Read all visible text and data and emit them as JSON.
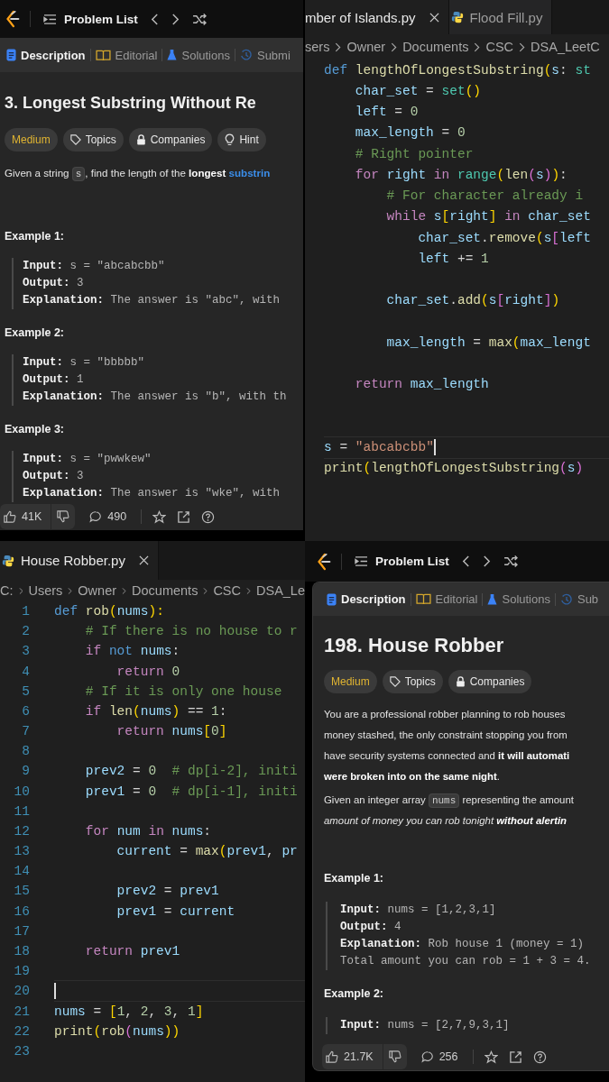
{
  "panels": [
    {
      "kind": "problem",
      "header": {
        "label": "Problem List"
      },
      "tabs": [
        {
          "kind": "description",
          "label": "Description",
          "selected": true
        },
        {
          "kind": "editorial",
          "label": "Editorial",
          "selected": false
        },
        {
          "kind": "solutions",
          "label": "Solutions",
          "selected": false
        },
        {
          "kind": "submissions",
          "label": "Submi",
          "selected": false
        }
      ],
      "title": "3. Longest Substring Without Re",
      "tags": [
        {
          "kind": "difficulty",
          "label": "Medium"
        },
        {
          "kind": "topics",
          "label": "Topics"
        },
        {
          "kind": "companies",
          "label": "Companies"
        },
        {
          "kind": "hint",
          "label": "Hint"
        }
      ],
      "paragraphs": [
        {
          "parts": [
            {
              "kind": "text",
              "text": "Given a string "
            },
            {
              "kind": "code",
              "text": "s"
            },
            {
              "kind": "text",
              "text": ", find the length of the **longest** "
            },
            {
              "kind": "link",
              "text": "substrin"
            }
          ]
        }
      ],
      "examples": [
        {
          "heading": "Example 1:",
          "lines": [
            {
              "label": "Input:",
              "value": "s = \"abcabcbb\""
            },
            {
              "label": "Output:",
              "value": "3"
            },
            {
              "label": "Explanation:",
              "value": "The answer is \"abc\", with"
            }
          ]
        },
        {
          "heading": "Example 2:",
          "lines": [
            {
              "label": "Input:",
              "value": "s = \"bbbbb\""
            },
            {
              "label": "Output:",
              "value": "1"
            },
            {
              "label": "Explanation:",
              "value": "The answer is \"b\", with th"
            }
          ]
        },
        {
          "heading": "Example 3:",
          "lines": [
            {
              "label": "Input:",
              "value": "s = \"pwwkew\""
            },
            {
              "label": "Output:",
              "value": "3"
            },
            {
              "label": "Explanation:",
              "value": "The answer is \"wke\", with"
            }
          ]
        }
      ],
      "footer": {
        "likes": "41K",
        "comments": "490"
      }
    },
    {
      "kind": "editor",
      "tabs": [
        {
          "label": "mber of Islands.py",
          "selected": true,
          "has_icon": false,
          "closable": true
        },
        {
          "label": "Flood Fill.py",
          "selected": false,
          "has_icon": true,
          "closable": false
        }
      ],
      "breadcrumb": [
        "sers",
        "Owner",
        "Documents",
        "CSC",
        "DSA_LeetC"
      ],
      "lines": [
        {
          "current": false,
          "tokens": [
            {
              "text": "def ",
              "kind": "st"
            },
            {
              "text": "lengthOfLongestSubstring",
              "kind": "fn"
            },
            {
              "text": "(",
              "kind": "b1"
            },
            {
              "text": "s",
              "kind": "var"
            },
            {
              "text": ": ",
              "kind": "op"
            },
            {
              "text": "st",
              "kind": "ty"
            }
          ]
        },
        {
          "current": false,
          "tokens": [
            {
              "text": "    char_set",
              "kind": "var"
            },
            {
              "text": " = ",
              "kind": "op"
            },
            {
              "text": "set",
              "kind": "ty"
            },
            {
              "text": "()",
              "kind": "b1"
            }
          ]
        },
        {
          "current": false,
          "tokens": [
            {
              "text": "    left",
              "kind": "var"
            },
            {
              "text": " = ",
              "kind": "op"
            },
            {
              "text": "0",
              "kind": "num"
            }
          ]
        },
        {
          "current": false,
          "tokens": [
            {
              "text": "    max_length",
              "kind": "var"
            },
            {
              "text": " = ",
              "kind": "op"
            },
            {
              "text": "0",
              "kind": "num"
            }
          ]
        },
        {
          "current": false,
          "tokens": [
            {
              "text": "    # Right pointer",
              "kind": "cm"
            }
          ]
        },
        {
          "current": false,
          "tokens": [
            {
              "text": "    for ",
              "kind": "kw"
            },
            {
              "text": "right ",
              "kind": "var"
            },
            {
              "text": "in ",
              "kind": "kw"
            },
            {
              "text": "range",
              "kind": "ty"
            },
            {
              "text": "(",
              "kind": "b1"
            },
            {
              "text": "len",
              "kind": "fn"
            },
            {
              "text": "(",
              "kind": "b2"
            },
            {
              "text": "s",
              "kind": "var"
            },
            {
              "text": ")",
              "kind": "b2"
            },
            {
              "text": ")",
              "kind": "b1"
            },
            {
              "text": ":",
              "kind": "op"
            }
          ]
        },
        {
          "current": false,
          "tokens": [
            {
              "text": "        # For character already i",
              "kind": "cm"
            }
          ]
        },
        {
          "current": false,
          "tokens": [
            {
              "text": "        while ",
              "kind": "kw"
            },
            {
              "text": "s",
              "kind": "var"
            },
            {
              "text": "[",
              "kind": "b1"
            },
            {
              "text": "right",
              "kind": "var"
            },
            {
              "text": "]",
              "kind": "b1"
            },
            {
              "text": " in ",
              "kind": "kw"
            },
            {
              "text": "char_set",
              "kind": "var"
            }
          ]
        },
        {
          "current": false,
          "tokens": [
            {
              "text": "            char_set",
              "kind": "var"
            },
            {
              "text": ".",
              "kind": "op"
            },
            {
              "text": "remove",
              "kind": "fn"
            },
            {
              "text": "(",
              "kind": "b1"
            },
            {
              "text": "s",
              "kind": "var"
            },
            {
              "text": "[",
              "kind": "b2"
            },
            {
              "text": "left",
              "kind": "var"
            }
          ]
        },
        {
          "current": false,
          "tokens": [
            {
              "text": "            left",
              "kind": "var"
            },
            {
              "text": " += ",
              "kind": "op"
            },
            {
              "text": "1",
              "kind": "num"
            }
          ]
        },
        {
          "current": false
        },
        {
          "current": false,
          "tokens": [
            {
              "text": "        char_set",
              "kind": "var"
            },
            {
              "text": ".",
              "kind": "op"
            },
            {
              "text": "add",
              "kind": "fn"
            },
            {
              "text": "(",
              "kind": "b1"
            },
            {
              "text": "s",
              "kind": "var"
            },
            {
              "text": "[",
              "kind": "b2"
            },
            {
              "text": "right",
              "kind": "var"
            },
            {
              "text": "]",
              "kind": "b2"
            },
            {
              "text": ")",
              "kind": "b1"
            }
          ]
        },
        {
          "current": false
        },
        {
          "current": false,
          "tokens": [
            {
              "text": "        max_length",
              "kind": "var"
            },
            {
              "text": " = ",
              "kind": "op"
            },
            {
              "text": "max",
              "kind": "fn"
            },
            {
              "text": "(",
              "kind": "b1"
            },
            {
              "text": "max_lengt",
              "kind": "var"
            }
          ]
        },
        {
          "current": false
        },
        {
          "current": false,
          "tokens": [
            {
              "text": "    return ",
              "kind": "kw"
            },
            {
              "text": "max_length",
              "kind": "var"
            }
          ]
        },
        {
          "current": false
        },
        {
          "current": false
        },
        {
          "current": true,
          "tokens": [
            {
              "text": "s",
              "kind": "var"
            },
            {
              "text": " = ",
              "kind": "op"
            },
            {
              "text": "\"abcabcbb\"",
              "kind": "str"
            }
          ]
        },
        {
          "current": false,
          "tokens": [
            {
              "text": "print",
              "kind": "fn"
            },
            {
              "text": "(",
              "kind": "b1"
            },
            {
              "text": "lengthOfLongestSubstring",
              "kind": "fn"
            },
            {
              "text": "(",
              "kind": "b2"
            },
            {
              "text": "s",
              "kind": "var"
            },
            {
              "text": ")",
              "kind": "b2"
            }
          ]
        }
      ]
    },
    {
      "kind": "editor",
      "tabs": [
        {
          "label": "House Robber.py",
          "selected": true,
          "has_icon": true,
          "closable": true
        }
      ],
      "breadcrumb": [
        "C:",
        "Users",
        "Owner",
        "Documents",
        "CSC",
        "DSA_Le"
      ],
      "lines": [
        {
          "number": "1",
          "current": false,
          "tokens": [
            {
              "text": "def ",
              "kind": "st"
            },
            {
              "text": "rob",
              "kind": "fn"
            },
            {
              "text": "(",
              "kind": "b1"
            },
            {
              "text": "nums",
              "kind": "var"
            },
            {
              "text": "):",
              "kind": "b1"
            }
          ]
        },
        {
          "number": "2",
          "current": false,
          "tokens": [
            {
              "text": "    # If there is no house to r",
              "kind": "cm"
            }
          ]
        },
        {
          "number": "3",
          "current": false,
          "tokens": [
            {
              "text": "    if ",
              "kind": "kw"
            },
            {
              "text": "not ",
              "kind": "st"
            },
            {
              "text": "nums",
              "kind": "var"
            },
            {
              "text": ":",
              "kind": "op"
            }
          ]
        },
        {
          "number": "4",
          "current": false,
          "tokens": [
            {
              "text": "        return ",
              "kind": "kw"
            },
            {
              "text": "0",
              "kind": "num"
            }
          ]
        },
        {
          "number": "5",
          "current": false,
          "tokens": [
            {
              "text": "    # If it is only one house",
              "kind": "cm"
            }
          ]
        },
        {
          "number": "6",
          "current": false,
          "tokens": [
            {
              "text": "    if ",
              "kind": "kw"
            },
            {
              "text": "len",
              "kind": "fn"
            },
            {
              "text": "(",
              "kind": "b1"
            },
            {
              "text": "nums",
              "kind": "var"
            },
            {
              "text": ")",
              "kind": "b1"
            },
            {
              "text": " == ",
              "kind": "op"
            },
            {
              "text": "1",
              "kind": "num"
            },
            {
              "text": ":",
              "kind": "op"
            }
          ]
        },
        {
          "number": "7",
          "current": false,
          "tokens": [
            {
              "text": "        return ",
              "kind": "kw"
            },
            {
              "text": "nums",
              "kind": "var"
            },
            {
              "text": "[",
              "kind": "b1"
            },
            {
              "text": "0",
              "kind": "num"
            },
            {
              "text": "]",
              "kind": "b1"
            }
          ]
        },
        {
          "number": "8",
          "current": false
        },
        {
          "number": "9",
          "current": false,
          "tokens": [
            {
              "text": "    prev2",
              "kind": "var"
            },
            {
              "text": " = ",
              "kind": "op"
            },
            {
              "text": "0",
              "kind": "num"
            },
            {
              "text": "  # dp[i-2], initi",
              "kind": "cm"
            }
          ]
        },
        {
          "number": "10",
          "current": false,
          "tokens": [
            {
              "text": "    prev1",
              "kind": "var"
            },
            {
              "text": " = ",
              "kind": "op"
            },
            {
              "text": "0",
              "kind": "num"
            },
            {
              "text": "  # dp[i-1], initi",
              "kind": "cm"
            }
          ]
        },
        {
          "number": "11",
          "current": false
        },
        {
          "number": "12",
          "current": false,
          "tokens": [
            {
              "text": "    for ",
              "kind": "kw"
            },
            {
              "text": "num ",
              "kind": "var"
            },
            {
              "text": "in ",
              "kind": "kw"
            },
            {
              "text": "nums",
              "kind": "var"
            },
            {
              "text": ":",
              "kind": "op"
            }
          ]
        },
        {
          "number": "13",
          "current": false,
          "tokens": [
            {
              "text": "        current",
              "kind": "var"
            },
            {
              "text": " = ",
              "kind": "op"
            },
            {
              "text": "max",
              "kind": "fn"
            },
            {
              "text": "(",
              "kind": "b1"
            },
            {
              "text": "prev1",
              "kind": "var"
            },
            {
              "text": ", ",
              "kind": "op"
            },
            {
              "text": "pr",
              "kind": "var"
            }
          ]
        },
        {
          "number": "14",
          "current": false
        },
        {
          "number": "15",
          "current": false,
          "tokens": [
            {
              "text": "        prev2",
              "kind": "var"
            },
            {
              "text": " = ",
              "kind": "op"
            },
            {
              "text": "prev1",
              "kind": "var"
            }
          ]
        },
        {
          "number": "16",
          "current": false,
          "tokens": [
            {
              "text": "        prev1",
              "kind": "var"
            },
            {
              "text": " = ",
              "kind": "op"
            },
            {
              "text": "current",
              "kind": "var"
            }
          ]
        },
        {
          "number": "17",
          "current": false
        },
        {
          "number": "18",
          "current": false,
          "tokens": [
            {
              "text": "    return ",
              "kind": "kw"
            },
            {
              "text": "prev1",
              "kind": "var"
            }
          ]
        },
        {
          "number": "19",
          "current": false
        },
        {
          "number": "20",
          "current": true
        },
        {
          "number": "21",
          "current": false,
          "tokens": [
            {
              "text": "nums",
              "kind": "var"
            },
            {
              "text": " = ",
              "kind": "op"
            },
            {
              "text": "[",
              "kind": "b1"
            },
            {
              "text": "1",
              "kind": "num"
            },
            {
              "text": ", ",
              "kind": "op"
            },
            {
              "text": "2",
              "kind": "num"
            },
            {
              "text": ", ",
              "kind": "op"
            },
            {
              "text": "3",
              "kind": "num"
            },
            {
              "text": ", ",
              "kind": "op"
            },
            {
              "text": "1",
              "kind": "num"
            },
            {
              "text": "]",
              "kind": "b1"
            }
          ]
        },
        {
          "number": "22",
          "current": false,
          "tokens": [
            {
              "text": "print",
              "kind": "fn"
            },
            {
              "text": "(",
              "kind": "b1"
            },
            {
              "text": "rob",
              "kind": "fn"
            },
            {
              "text": "(",
              "kind": "b2"
            },
            {
              "text": "nums",
              "kind": "var"
            },
            {
              "text": "))",
              "kind": "b1"
            }
          ]
        },
        {
          "number": "23",
          "current": false
        }
      ]
    },
    {
      "kind": "problem",
      "header": {
        "label": "Problem List"
      },
      "tabs": [
        {
          "kind": "description",
          "label": "Description",
          "selected": true
        },
        {
          "kind": "editorial",
          "label": "Editorial",
          "selected": false
        },
        {
          "kind": "solutions",
          "label": "Solutions",
          "selected": false
        },
        {
          "kind": "submissions",
          "label": "Sub",
          "selected": false
        }
      ],
      "title": "198. House Robber",
      "tags": [
        {
          "kind": "difficulty",
          "label": "Medium"
        },
        {
          "kind": "topics",
          "label": "Topics"
        },
        {
          "kind": "companies",
          "label": "Companies"
        }
      ],
      "paragraphs": [
        {
          "parts": [
            {
              "kind": "text",
              "text": "You are a professional robber planning to rob houses\nmoney stashed, the only constraint stopping you from\nhave security systems connected and **it will automati**\n**were broken into on the same night**."
            }
          ]
        },
        {
          "parts": [
            {
              "kind": "text",
              "text": "Given an integer array "
            },
            {
              "kind": "code",
              "text": "nums"
            },
            {
              "kind": "text",
              "text": " representing the amount\n"
            },
            {
              "kind": "italic",
              "text": "amount of money you can rob tonight **without alertin**"
            }
          ]
        }
      ],
      "examples": [
        {
          "heading": "Example 1:",
          "lines": [
            {
              "label": "Input:",
              "value": "nums = [1,2,3,1]"
            },
            {
              "label": "Output:",
              "value": "4"
            },
            {
              "label": "Explanation:",
              "value": "Rob house 1 (money = 1)"
            },
            {
              "value": "Total amount you can rob = 1 + 3 = 4."
            }
          ]
        },
        {
          "heading": "Example 2:",
          "lines": [
            {
              "label": "Input:",
              "value": "nums = [2,7,9,3,1]"
            }
          ]
        }
      ],
      "footer": {
        "likes": "21.7K",
        "comments": "256"
      }
    }
  ]
}
